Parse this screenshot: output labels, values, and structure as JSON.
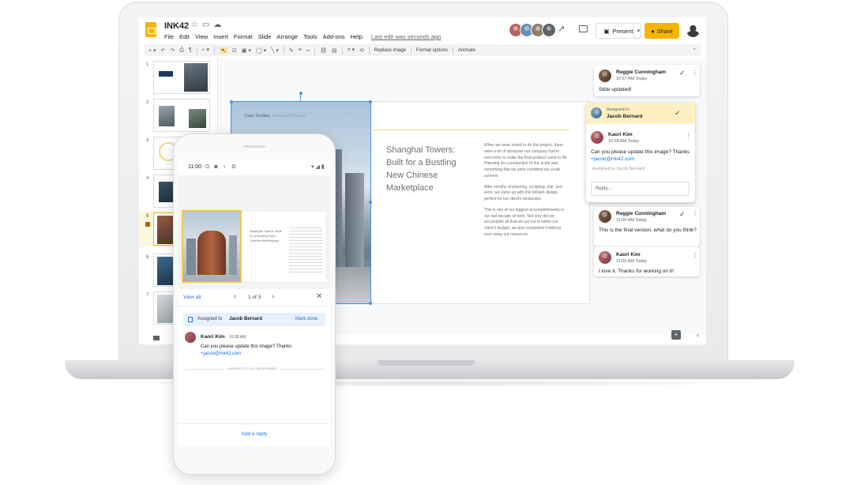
{
  "app": {
    "doc_title": "INK42",
    "menu": [
      "File",
      "Edit",
      "View",
      "Insert",
      "Format",
      "Slide",
      "Arrange",
      "Tools",
      "Add-ons",
      "Help"
    ],
    "last_edit": "Last edit was seconds ago",
    "present_label": "Present",
    "share_label": "Share",
    "colors": {
      "accent": "#f4b400",
      "link": "#1a73e8",
      "assigned_band": "#fef0c3"
    }
  },
  "toolbar": {
    "replace_image": "Replace image",
    "format_options": "Format options",
    "animate": "Animate"
  },
  "filmstrip": {
    "numbers": [
      "1",
      "2",
      "3",
      "4",
      "5",
      "6",
      "7"
    ],
    "selected": "5"
  },
  "slide": {
    "kicker": "Case Studies",
    "kicker_sub": "Shanghai Project",
    "heading": "Shanghai Towers: Built for a Bustling New Chinese Marketplace",
    "body": [
      "When we were asked to do this project, there were a lot of obstacles our company had to overcome to make the final product come to life Planning for a production of this scale was something that we were confident we could achieve.",
      "After months of planning, sculpting, trial, and error, we came up with this brilliant design, perfect for our client's landscape.",
      "This is one of our biggest accomplishments in our last decade of work. Not only did we accomplish all that we set out to within our client's budget, we also completed it without over using our resources."
    ]
  },
  "comments": [
    {
      "name": "Reggie Cunningham",
      "time": "10:57 AM Today",
      "text": "Slide updated!"
    },
    {
      "assigned_label": "Assigned to",
      "assignee": "Jacob Bernard",
      "name": "Kaori Kim",
      "time": "10:58 AM Today",
      "text": "Can you please update this image? Thanks",
      "mention": "+jacob@ink42.com",
      "footer": "Assigned to Jacob Bernard",
      "reply_placeholder": "Reply..."
    },
    {
      "name": "Reggie Cunningham",
      "time": "11:00 AM Today",
      "text": "This is the final version, what do you think?"
    },
    {
      "name": "Kaori Kim",
      "time": "11:05 AM Today",
      "text": "I love it. Thanks for working on it!"
    }
  ],
  "phone": {
    "time": "11:00",
    "view_all": "View all",
    "page_indicator": "1 of 3",
    "assigned_label": "Assigned to",
    "assignee": "Jacob Bernard",
    "mark_done": "Mark done",
    "comment_name": "Kaori Kim",
    "comment_time": "10:58 AM",
    "comment_text": "Can you please update this image? Thanks",
    "comment_mention": "+jacob@ink42.com",
    "divider_label": "ASSIGNED TO JACOB BERNARD",
    "add_reply": "Add a reply",
    "mini_heading": "Shanghai Towers: Built for a Bustling New Chinese Marketplace"
  }
}
